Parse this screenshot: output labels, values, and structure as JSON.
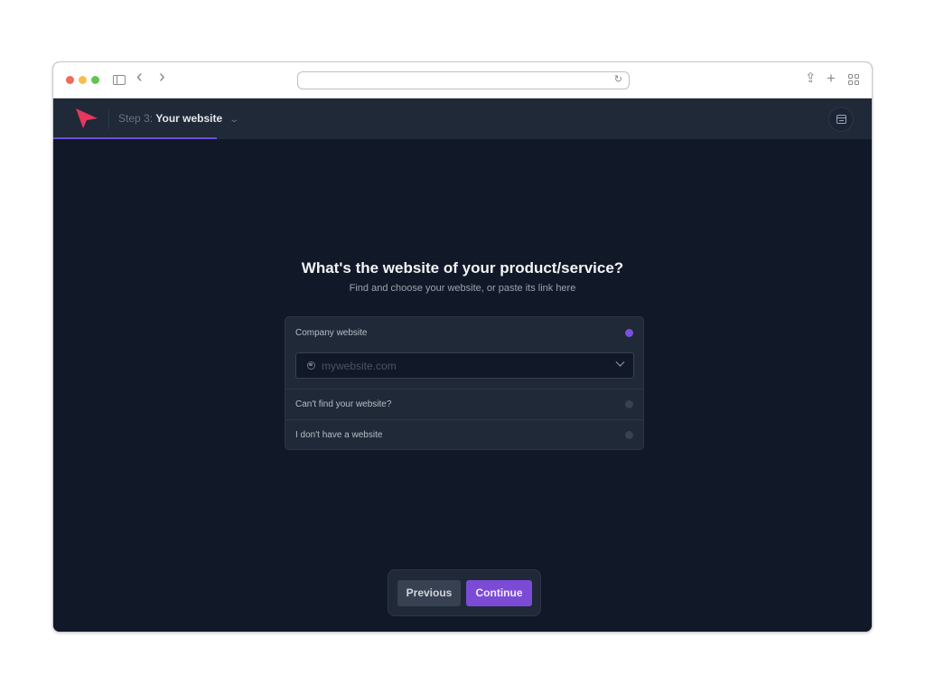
{
  "browser": {
    "url": "",
    "icons": {
      "sidebar": "sidebar-icon",
      "back": "chevron-left-icon",
      "forward": "chevron-right-icon",
      "reload": "reload-icon",
      "share": "share-icon",
      "new_tab": "plus-icon",
      "tab_overview": "grid-icon"
    },
    "glyphs": {
      "back": "‹",
      "forward": "›",
      "reload": "↻",
      "share": "⇪",
      "new_tab": "+"
    }
  },
  "header": {
    "step_prefix": "Step 3:",
    "step_title": "Your website",
    "step_chevron": "⌄",
    "progress_percent": 20,
    "logo_color": "#e8365d",
    "accent_color": "#6d4fd8"
  },
  "main": {
    "title": "What's the website of your product/service?",
    "subtitle": "Find and choose your website, or paste its link here",
    "options": [
      {
        "label": "Company website",
        "selected": true
      },
      {
        "label": "Can't find your website?",
        "selected": false
      },
      {
        "label": "I don't have a website",
        "selected": false
      }
    ],
    "website_select": {
      "placeholder": "mywebsite.com",
      "value": ""
    }
  },
  "footer": {
    "previous_label": "Previous",
    "continue_label": "Continue",
    "continue_color": "#7b4bd6"
  }
}
